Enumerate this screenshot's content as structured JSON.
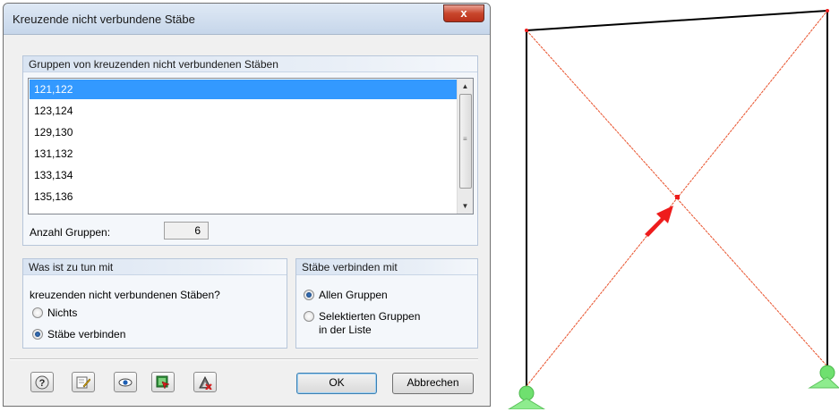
{
  "dialog": {
    "title": "Kreuzende nicht verbundene Stäbe",
    "close_glyph": "x",
    "groups_section": {
      "heading": "Gruppen von kreuzenden nicht verbundenen Stäben",
      "items": [
        "121,122",
        "123,124",
        "129,130",
        "131,132",
        "133,134",
        "135,136"
      ],
      "selected_index": 0,
      "count_label": "Anzahl Gruppen:",
      "count_value": "6"
    },
    "action_section": {
      "heading": "Was ist zu tun mit",
      "question": "kreuzenden nicht verbundenen Stäben?",
      "options": [
        "Nichts",
        "Stäbe verbinden"
      ],
      "selected": "Stäbe verbinden"
    },
    "connect_section": {
      "heading": "Stäbe verbinden mit",
      "options": [
        "Allen Gruppen",
        "Selektierten Gruppen",
        "in der Liste"
      ],
      "selected": "Allen Gruppen"
    },
    "footer": {
      "icons": [
        "help-icon",
        "edit-icon",
        "view-icon",
        "select-icon",
        "delete-icon"
      ],
      "ok_label": "OK",
      "cancel_label": "Abbrechen"
    }
  },
  "model_view": {
    "frame_color": "#000000",
    "cross_member_color": "#e8502a",
    "marker_color": "#ee1c1c",
    "support_color": "#6fe06f"
  }
}
